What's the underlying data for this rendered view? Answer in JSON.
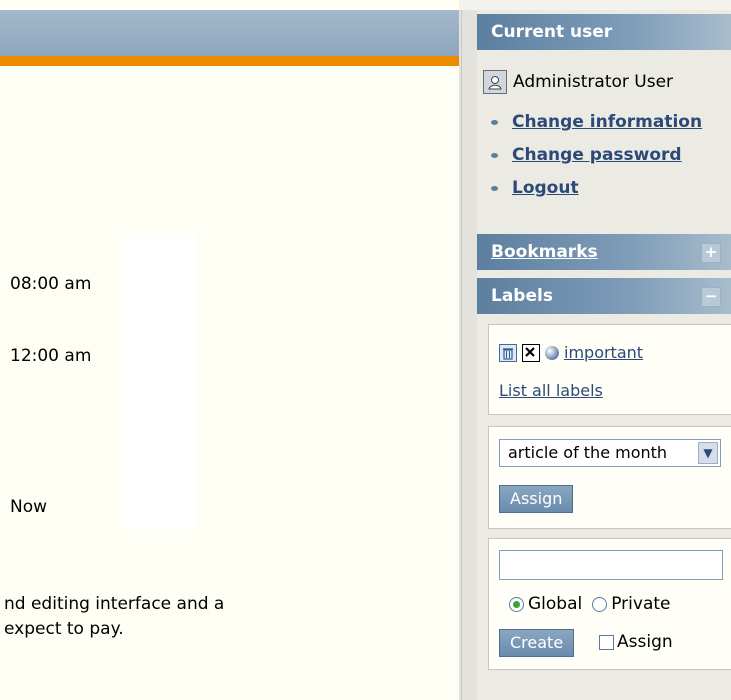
{
  "main": {
    "rows": [
      {
        "text": "08:00 am"
      },
      {
        "text": "12:00 am"
      },
      {
        "text": "Now"
      }
    ],
    "paragraph": {
      "line1": "nd editing interface and a",
      "line2": "expect to pay."
    }
  },
  "sidebar": {
    "current_user": {
      "title": "Current user",
      "user_name": "Administrator User",
      "links": [
        "Change information",
        "Change password",
        "Logout"
      ]
    },
    "bookmarks": {
      "title": "Bookmarks",
      "toggle": "+"
    },
    "labels": {
      "title": "Labels",
      "toggle": "−",
      "label_name": "important",
      "list_all": "List all labels",
      "select_value": "article of the month",
      "assign_button": "Assign",
      "new_label_value": "",
      "radio_global": "Global",
      "radio_private": "Private",
      "create_button": "Create",
      "assign_checkbox_label": "Assign"
    }
  },
  "colors": {
    "accent_orange": "#ec8b00",
    "header_blue": "#6f8fae",
    "link": "#2b4a7a"
  }
}
